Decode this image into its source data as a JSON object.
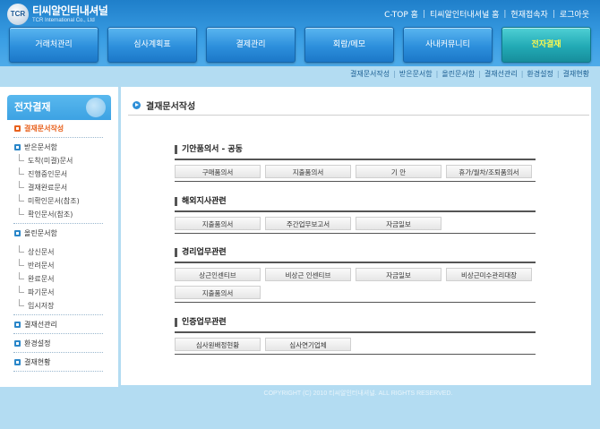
{
  "logo": {
    "mark": "TCR",
    "title": "티씨알인터내셔널",
    "subtitle": "TCR International Co., Ltd"
  },
  "top_links": [
    "C-TOP 홈",
    "티씨알인터내셔널 홈",
    "현재접속자",
    "로그아웃"
  ],
  "main_nav": [
    {
      "label": "거래처관리",
      "active": false
    },
    {
      "label": "심사계획표",
      "active": false
    },
    {
      "label": "결제관리",
      "active": false
    },
    {
      "label": "회람/메모",
      "active": false
    },
    {
      "label": "사내커뮤니티",
      "active": false
    },
    {
      "label": "전자결재",
      "active": true
    }
  ],
  "sub_nav": [
    "결재문서작성",
    "받은문서함",
    "올린문서함",
    "결재선관리",
    "환경설정",
    "결재현황"
  ],
  "sidebar": {
    "title": "전자결재",
    "items": [
      {
        "type": "main",
        "label": "결재문서작성",
        "current": true
      },
      {
        "type": "divider"
      },
      {
        "type": "main",
        "label": "받은문서함"
      },
      {
        "type": "sub",
        "label": "도착(미결)문서"
      },
      {
        "type": "sub",
        "label": "진행중인문서"
      },
      {
        "type": "sub",
        "label": "결재완료문서"
      },
      {
        "type": "sub",
        "label": "미확인문서(참조)"
      },
      {
        "type": "sub",
        "label": "확인문서(참조)"
      },
      {
        "type": "divider"
      },
      {
        "type": "main",
        "label": "올린문서함"
      },
      {
        "type": "gap"
      },
      {
        "type": "sub",
        "label": "상신문서"
      },
      {
        "type": "sub",
        "label": "반려문서"
      },
      {
        "type": "sub",
        "label": "완료문서"
      },
      {
        "type": "sub",
        "label": "파기문서"
      },
      {
        "type": "sub",
        "label": "임시저장"
      },
      {
        "type": "divider"
      },
      {
        "type": "main",
        "label": "결재선관리"
      },
      {
        "type": "divider"
      },
      {
        "type": "main",
        "label": "환경설정"
      },
      {
        "type": "divider"
      },
      {
        "type": "main",
        "label": "결재현황"
      },
      {
        "type": "divider"
      }
    ]
  },
  "content": {
    "title": "결재문서작성",
    "sections": [
      {
        "title": "기안품의서 - 공동",
        "buttons": [
          "구매품의서",
          "지출품의서",
          "기 안",
          "휴가/월차/조퇴품의서"
        ]
      },
      {
        "title": "해외지사관련",
        "buttons": [
          "지출품의서",
          "주간업무보고서",
          "자금일보"
        ]
      },
      {
        "title": "경리업무관련",
        "buttons": [
          "상근인센티브",
          "비상근 인센티브",
          "자금일보",
          "비상근미수관리대장",
          "지출품의서"
        ]
      },
      {
        "title": "인증업무관련",
        "buttons": [
          "심사원배정현황",
          "심사연기업체"
        ]
      }
    ]
  },
  "footer": "COPYRIGHT (C) 2010 티씨알인터내셔널. ALL RIGHTS RESERVED."
}
